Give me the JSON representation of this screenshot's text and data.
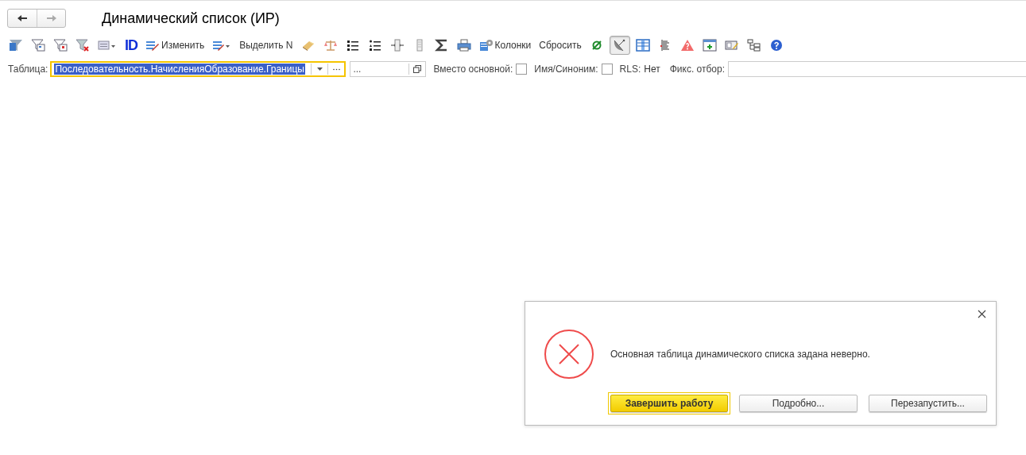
{
  "header": {
    "title": "Динамический список (ИР)",
    "nav": [
      {
        "kind": "back",
        "disabled": false
      },
      {
        "kind": "forward",
        "disabled": true
      }
    ]
  },
  "toolbar": [
    {
      "kind": "filter"
    },
    {
      "kind": "filter-card"
    },
    {
      "kind": "filter-flag"
    },
    {
      "kind": "filter-clear"
    },
    {
      "kind": "list-menu"
    },
    {
      "kind": "id-text",
      "label": "ID"
    },
    {
      "kind": "edit",
      "label": "Изменить"
    },
    {
      "kind": "edit-menu"
    },
    {
      "kind": "text",
      "label": "Выделить N"
    },
    {
      "kind": "eraser"
    },
    {
      "kind": "scales"
    },
    {
      "kind": "list"
    },
    {
      "kind": "list-symbols"
    },
    {
      "kind": "column-move"
    },
    {
      "kind": "column"
    },
    {
      "kind": "sigma"
    },
    {
      "kind": "printer"
    },
    {
      "kind": "columns",
      "label": "Колонки"
    },
    {
      "kind": "text",
      "label": "Сбросить"
    },
    {
      "kind": "null"
    },
    {
      "kind": "dish",
      "pressed": true
    },
    {
      "kind": "table"
    },
    {
      "kind": "lines"
    },
    {
      "kind": "warning"
    },
    {
      "kind": "window-add"
    },
    {
      "kind": "card-edit"
    },
    {
      "kind": "tree"
    },
    {
      "kind": "help"
    }
  ],
  "filter_row": {
    "table_label": "Таблица:",
    "table_value": "Последовательность.НачисленияОбразование.Границы",
    "table_focused": true,
    "extra_value": "...",
    "instead_label": "Вместо основной:",
    "instead_checked": false,
    "synonym_label": "Имя/Синоним:",
    "synonym_checked": false,
    "rls_label": "RLS:",
    "rls_value": "Нет",
    "fixed_label": "Фикс. отбор:"
  },
  "dialog": {
    "message": "Основная таблица динамического списка задана неверно.",
    "buttons": [
      {
        "label": "Завершить работу",
        "default": true
      },
      {
        "label": "Подробно..."
      },
      {
        "label": "Перезапустить..."
      }
    ]
  }
}
